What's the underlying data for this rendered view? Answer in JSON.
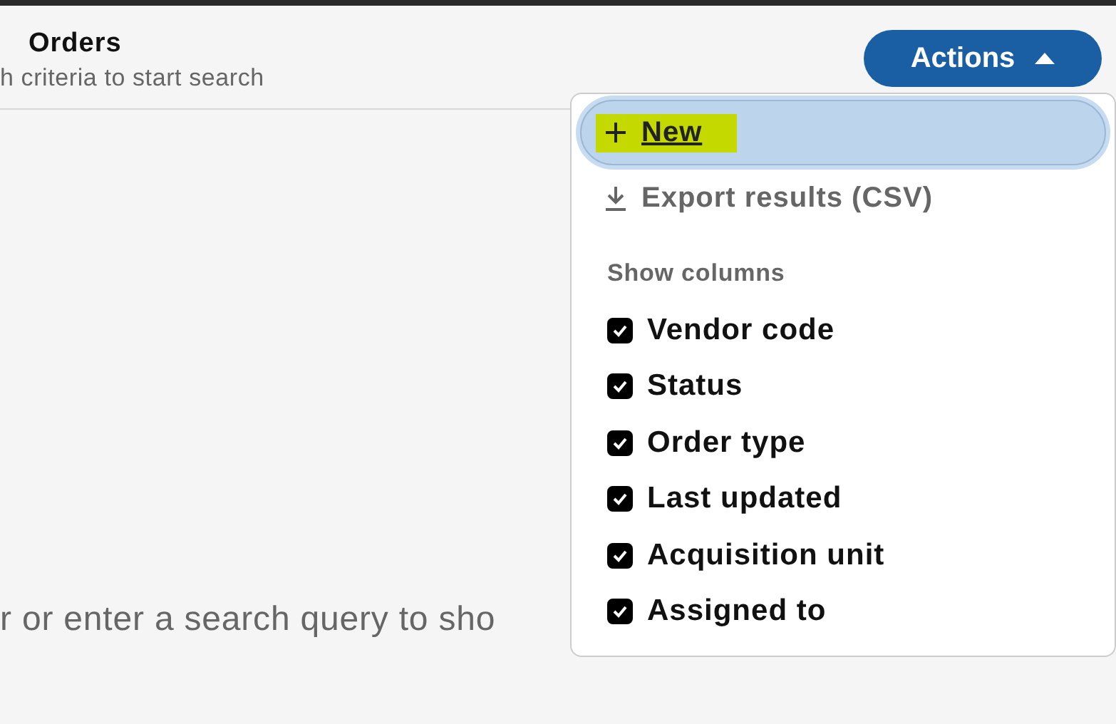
{
  "header": {
    "title": "Orders",
    "subtitle": "h criteria to start search"
  },
  "empty_message": "r or enter a search query to sho",
  "actions_button": {
    "label": "Actions",
    "expanded": true
  },
  "actions_menu": {
    "items": [
      {
        "label": "New",
        "kind": "create",
        "focused": true,
        "highlighted": true
      },
      {
        "label": "Export results (CSV)",
        "kind": "export",
        "focused": false,
        "highlighted": false
      }
    ],
    "section_title": "Show columns",
    "columns": [
      {
        "label": "Vendor code",
        "checked": true
      },
      {
        "label": "Status",
        "checked": true
      },
      {
        "label": "Order type",
        "checked": true
      },
      {
        "label": "Last updated",
        "checked": true
      },
      {
        "label": "Acquisition unit",
        "checked": true
      },
      {
        "label": "Assigned to",
        "checked": true
      }
    ]
  }
}
